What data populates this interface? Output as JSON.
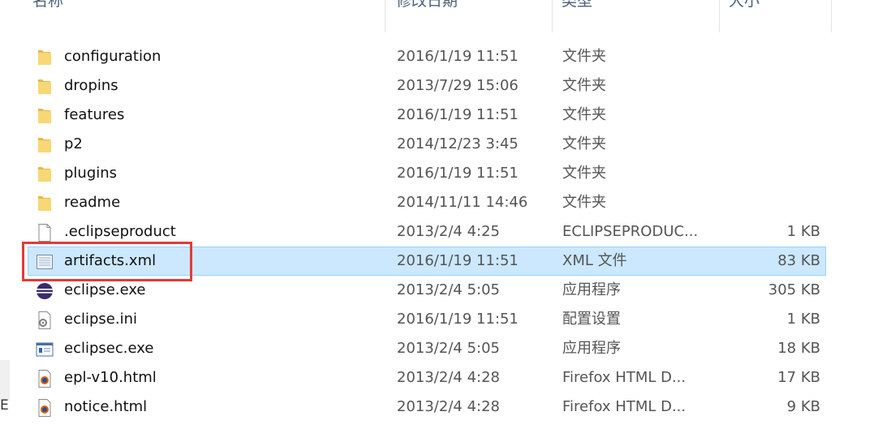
{
  "header": {
    "name": "名称",
    "date": "修改日期",
    "type": "类型",
    "size": "大小"
  },
  "nav_pane_fragment": "E",
  "files": [
    {
      "name": "configuration",
      "date": "2016/1/19 11:51",
      "type": "文件夹",
      "size": "",
      "icon": "folder-icon"
    },
    {
      "name": "dropins",
      "date": "2013/7/29 15:06",
      "type": "文件夹",
      "size": "",
      "icon": "folder-icon"
    },
    {
      "name": "features",
      "date": "2016/1/19 11:51",
      "type": "文件夹",
      "size": "",
      "icon": "folder-icon"
    },
    {
      "name": "p2",
      "date": "2014/12/23 3:45",
      "type": "文件夹",
      "size": "",
      "icon": "folder-icon"
    },
    {
      "name": "plugins",
      "date": "2016/1/19 11:51",
      "type": "文件夹",
      "size": "",
      "icon": "folder-icon"
    },
    {
      "name": "readme",
      "date": "2014/11/11 14:46",
      "type": "文件夹",
      "size": "",
      "icon": "folder-icon"
    },
    {
      "name": ".eclipseproduct",
      "date": "2013/2/4 4:25",
      "type": "ECLIPSEPRODUC...",
      "size": "1 KB",
      "icon": "blank-file-icon"
    },
    {
      "name": "artifacts.xml",
      "date": "2016/1/19 11:51",
      "type": "XML 文件",
      "size": "83 KB",
      "icon": "xml-file-icon",
      "selected": true
    },
    {
      "name": "eclipse.exe",
      "date": "2013/2/4 5:05",
      "type": "应用程序",
      "size": "305 KB",
      "icon": "eclipse-icon"
    },
    {
      "name": "eclipse.ini",
      "date": "2016/1/19 11:51",
      "type": "配置设置",
      "size": "1 KB",
      "icon": "config-file-icon"
    },
    {
      "name": "eclipsec.exe",
      "date": "2013/2/4 5:05",
      "type": "应用程序",
      "size": "18 KB",
      "icon": "console-app-icon"
    },
    {
      "name": "epl-v10.html",
      "date": "2013/2/4 4:28",
      "type": "Firefox HTML D...",
      "size": "17 KB",
      "icon": "firefox-html-icon"
    },
    {
      "name": "notice.html",
      "date": "2013/2/4 4:28",
      "type": "Firefox HTML D...",
      "size": "9 KB",
      "icon": "firefox-html-icon"
    }
  ],
  "colors": {
    "selection_bg": "#cce8ff",
    "selection_border": "#99d1ff",
    "annotation_red": "#e53935",
    "folder_yellow": "#f8d775"
  }
}
